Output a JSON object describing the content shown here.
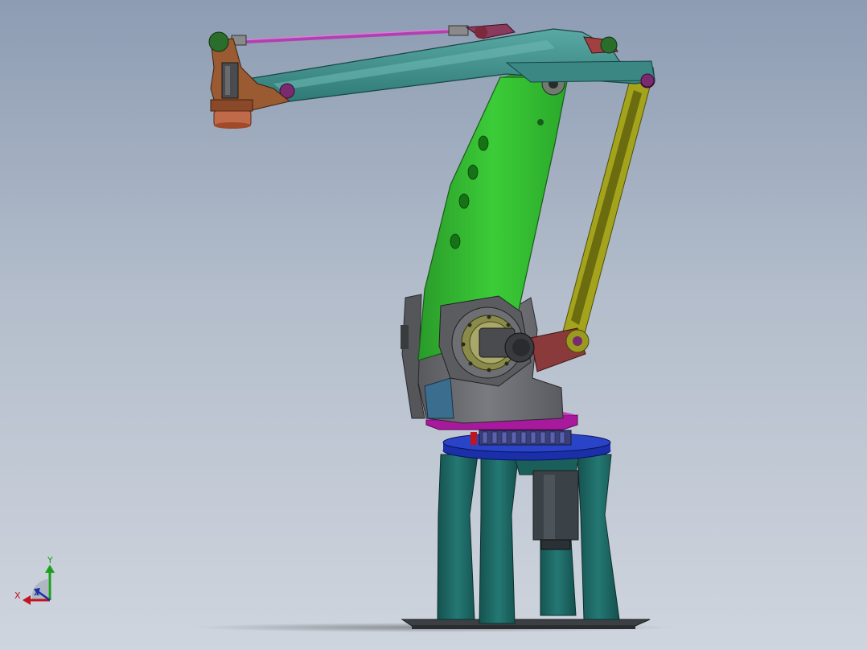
{
  "triad": {
    "x_label": "X",
    "y_label": "Y",
    "z_label": "Z"
  },
  "colors": {
    "background_top": "#8d9cb3",
    "background_bottom": "#cfd5de",
    "base_legs": "#1f6e6a",
    "turntable_blue": "#1a2fa8",
    "turntable_magenta": "#b01fa8",
    "lower_arm_green": "#2fb82f",
    "upper_arm_teal": "#3f8f8c",
    "link_rod_olive": "#9a9a1a",
    "tie_rod_magenta": "#b040b0",
    "wrist_brown": "#9a5a32",
    "housing_gray": "#6e6e72"
  },
  "icons": {
    "triad": "coordinate-triad-icon"
  }
}
